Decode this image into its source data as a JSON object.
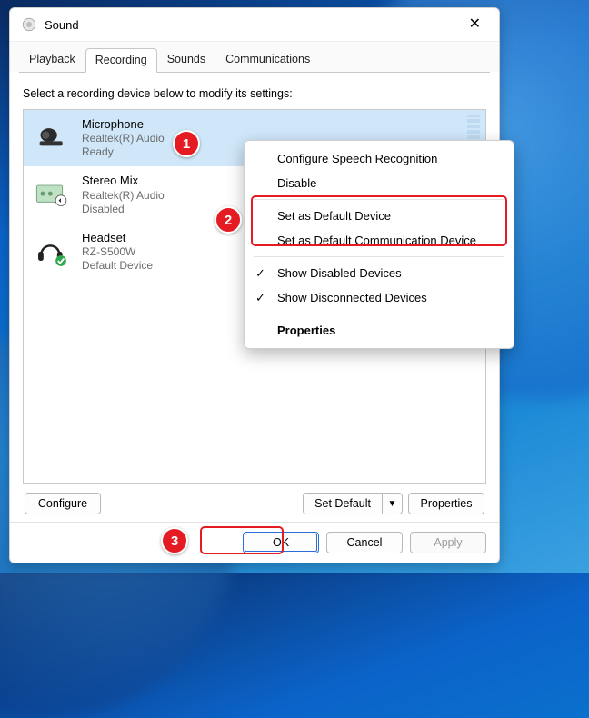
{
  "window": {
    "title": "Sound"
  },
  "tabs": [
    {
      "label": "Playback"
    },
    {
      "label": "Recording"
    },
    {
      "label": "Sounds"
    },
    {
      "label": "Communications"
    }
  ],
  "active_tab": 1,
  "instruction": "Select a recording device below to modify its settings:",
  "devices": [
    {
      "name": "Microphone",
      "driver": "Realtek(R) Audio",
      "status": "Ready",
      "selected": true,
      "kind": "webcam"
    },
    {
      "name": "Stereo Mix",
      "driver": "Realtek(R) Audio",
      "status": "Disabled",
      "selected": false,
      "kind": "board"
    },
    {
      "name": "Headset",
      "driver": "RZ-S500W",
      "status": "Default Device",
      "selected": false,
      "kind": "headset"
    }
  ],
  "buttons": {
    "configure": "Configure",
    "set_default": "Set Default",
    "properties": "Properties",
    "ok": "OK",
    "cancel": "Cancel",
    "apply": "Apply"
  },
  "context_menu": {
    "items": [
      {
        "label": "Configure Speech Recognition"
      },
      {
        "label": "Disable"
      }
    ],
    "highlighted": [
      {
        "label": "Set as Default Device"
      },
      {
        "label": "Set as Default Communication Device"
      }
    ],
    "checked": [
      {
        "label": "Show Disabled Devices"
      },
      {
        "label": "Show Disconnected Devices"
      }
    ],
    "properties": "Properties"
  },
  "annotations": {
    "b1": "1",
    "b2": "2",
    "b3": "3"
  }
}
